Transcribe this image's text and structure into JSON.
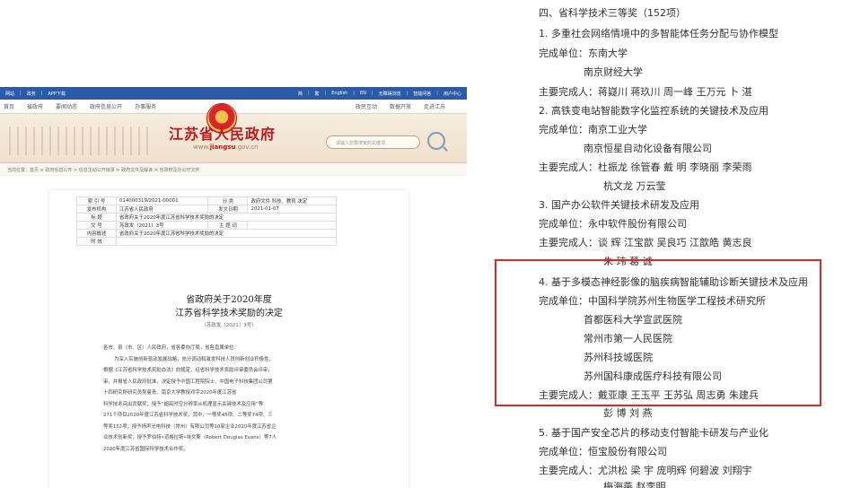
{
  "website": {
    "topbar": {
      "left": [
        "网站",
        "政务",
        "APP下载"
      ],
      "right": [
        "简",
        "繁",
        "English",
        "EN",
        "无障碍浏览",
        "智能问答",
        "用户中心"
      ]
    },
    "nav": {
      "left": [
        "首页",
        "省政府",
        "要闻动态",
        "政府信息公开",
        "办事服务"
      ],
      "right": [
        "政民互动",
        "数据开放",
        "走进江苏"
      ]
    },
    "site_title": "江苏省人民政府",
    "site_url_prefix": "www.",
    "site_url_brand": "jiangsu",
    "site_url_suffix": ".gov.cn",
    "search_placeholder": "请输入您要搜索的关键词",
    "breadcrumb": "当前位置：首页 > 政府信息公开 > 信息主动公开目录 > 政府文件及解读 > 省政府及办公厅文件",
    "meta": {
      "index_no_label": "索 引 号",
      "index_no": "014000319/2021-00001",
      "category_label": "分    类",
      "category": "政府文件 科技、教育 决定",
      "issuer_label": "发布机构",
      "issuer": "江苏省人民政府",
      "date_label": "发文日期",
      "date": "2021-01-07",
      "title_label": "标    题",
      "title": "省政府关于2020年度江苏省科学技术奖励的决定",
      "docno_label": "文    号",
      "docno": "苏政发〔2021〕3号",
      "topic_label": "主 题 词",
      "topic": "",
      "summary_label": "内容概述",
      "summary": "省政府关于2020年度江苏省科学技术奖励的决定",
      "validity_label": "时    效",
      "validity": ""
    },
    "doc_title_1": "省政府关于2020年度",
    "doc_title_2": "江苏省科学技术奖励的决定",
    "doc_number": "（苏政发〔2021〕3号）",
    "doc_body": [
      "各市、县（市、区）人民政府，省各委办厅局，省各直属单位：",
      "为深入实施创新驱动发展战略，充分调动和激发科技人员创新创业积极性，",
      "根据《江苏省科学技术奖励办法》的规定，经省科学技术奖励评审委员会评审，",
      "审，并报省人民政府批准，决定授予中国工程院院士、中国电子科技集团公司第",
      "十四研究所研究员吴曼青、南京大学教授邓宇2020年度江苏省",
      "科学技术突出贡献奖；授予“超高时空分辨率从机理显示关键技术及应用”等",
      "271个项目2020年度江苏省科学技术奖，其中，一等奖45项、二等奖74项、三",
      "等奖152项；授予扬声光电科技（常州）有限公司等10家企业2020年度江苏省企",
      "业技术创新奖；授予罗伯特•道格拉斯•埃文斯（Robert Douglas Evans）等7人",
      "2020年度江苏省国际科学技术合作奖。"
    ]
  },
  "award_list": {
    "section_header": "四、省科学技术三等奖（152项）",
    "item1_title": "1. 多重社会网络情境中的多智能体任务分配与协作模型",
    "item1_unit_label": "完成单位：",
    "item1_units": [
      "东南大学",
      "南京财经大学"
    ],
    "item1_people_label": "主要完成人：",
    "item1_people": "蒋嶷川  蒋玖川  周一峰  王万元  卜  湛",
    "item2_title": "2. 高铁变电站智能数字化监控系统的关键技术及应用",
    "item2_unit_label": "完成单位：",
    "item2_units": [
      "南京工业大学",
      "南京恒星自动化设备有限公司"
    ],
    "item2_people_label": "主要完成人：",
    "item2_people_1": "杜振龙  徐管春  戴  明  李晓丽  李荣雨",
    "item2_people_2": "杭文龙  万云莹",
    "item3_title": "3. 国产办公软件关键技术研发及应用",
    "item3_unit_label": "完成单位：",
    "item3_units": [
      "永中软件股份有限公司"
    ],
    "item3_people_label": "主要完成人：",
    "item3_people_1": "谈  辉  江宝歆  吴良巧  江歆皓  黄志良",
    "item3_people_2": "朱  玮  葛  诚",
    "item4_title": "4. 基于多模态神经影像的脑疾病智能辅助诊断关键技术及应用",
    "item4_unit_label": "完成单位：",
    "item4_units": [
      "中国科学院苏州生物医学工程技术研究所",
      "首都医科大学宣武医院",
      "常州市第一人民医院",
      "苏州科技城医院",
      "苏州国科康成医疗科技有限公司"
    ],
    "item4_people_label": "主要完成人：",
    "item4_people_1": "戴亚康  王玉平  王苏弘  周志勇  朱建兵",
    "item4_people_2": "彭  博  刘  燕",
    "item5_title": "5. 基于国产安全芯片的移动支付智能卡研发与产业化",
    "item5_unit_label": "完成单位：",
    "item5_units": [
      "恒宝股份有限公司"
    ],
    "item5_people_label": "主要完成人：",
    "item5_people_1": "尤洪松  梁  宇  庞明辉  何碧波  刘翔宇",
    "item5_people_2": "梅海燕  赵李明",
    "highlight_color": "#e3262c"
  }
}
